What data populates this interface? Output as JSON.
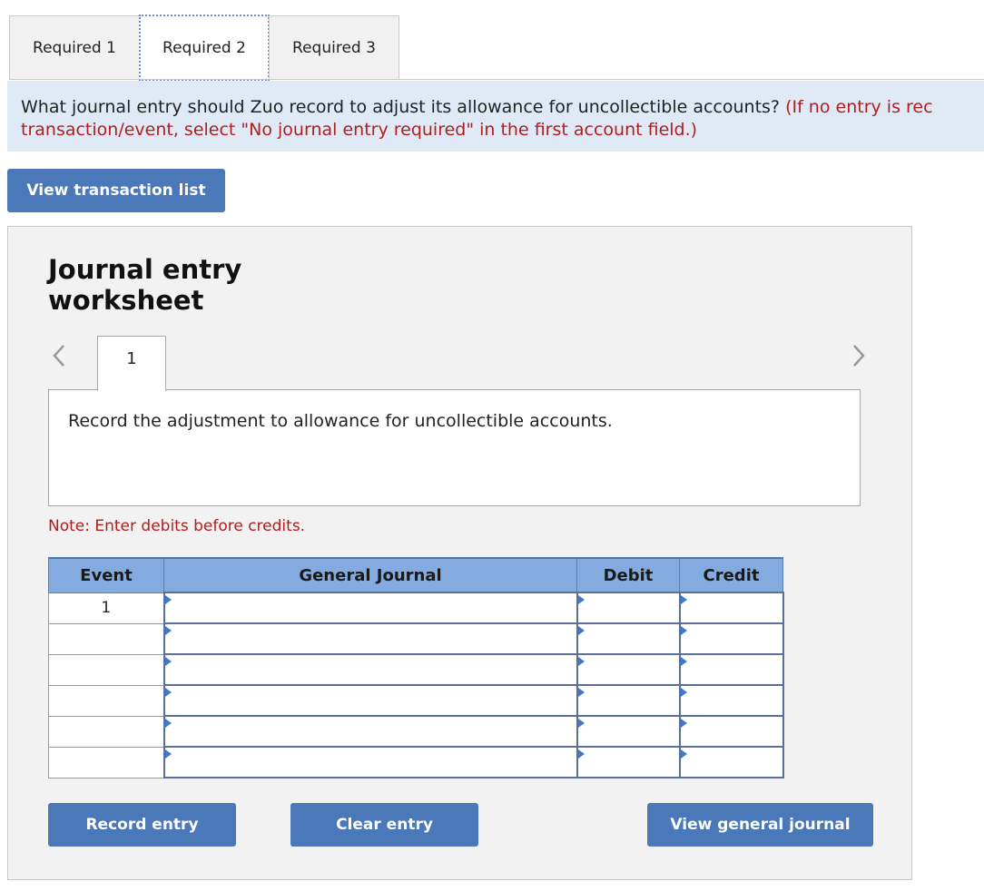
{
  "tabs": [
    {
      "label": "Required 1"
    },
    {
      "label": "Required 2"
    },
    {
      "label": "Required 3"
    }
  ],
  "question": {
    "text": "What journal entry should Zuo record to adjust its allowance for uncollectible accounts?",
    "note_line1": "(If no entry is rec",
    "note_line2": "transaction/event, select \"No journal entry required\" in the first account field.)"
  },
  "buttons": {
    "view_transaction_list": "View transaction list",
    "record_entry": "Record entry",
    "clear_entry": "Clear entry",
    "view_general_journal": "View general journal"
  },
  "worksheet": {
    "title_line1": "Journal entry",
    "title_line2": "worksheet",
    "step": "1",
    "instruction": "Record the adjustment to allowance for uncollectible accounts.",
    "note": "Note: Enter debits before credits."
  },
  "table": {
    "headers": {
      "event": "Event",
      "general_journal": "General Journal",
      "debit": "Debit",
      "credit": "Credit"
    },
    "rows": [
      {
        "event": "1",
        "account": "",
        "debit": "",
        "credit": ""
      },
      {
        "event": "",
        "account": "",
        "debit": "",
        "credit": ""
      },
      {
        "event": "",
        "account": "",
        "debit": "",
        "credit": ""
      },
      {
        "event": "",
        "account": "",
        "debit": "",
        "credit": ""
      },
      {
        "event": "",
        "account": "",
        "debit": "",
        "credit": ""
      },
      {
        "event": "",
        "account": "",
        "debit": "",
        "credit": ""
      }
    ]
  },
  "icons": {
    "prev": "chevron-left-icon",
    "next": "chevron-right-icon"
  },
  "colors": {
    "button": "#4a78b8",
    "header": "#84abe0",
    "banner": "#dfeaf6",
    "note": "#b01e1e"
  }
}
